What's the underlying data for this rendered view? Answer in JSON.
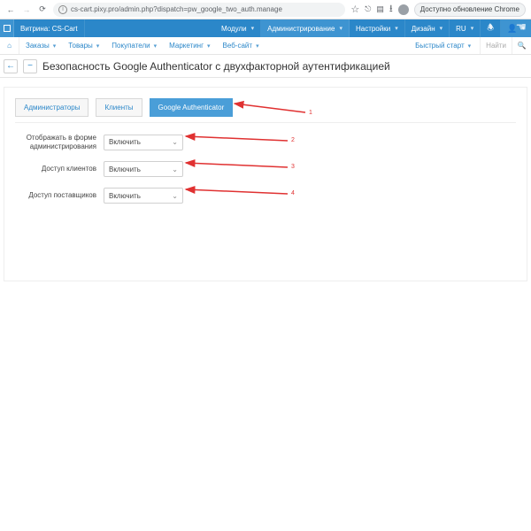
{
  "chrome": {
    "url": "cs-cart.pixy.pro/admin.php?dispatch=pw_google_two_auth.manage",
    "update_label": "Доступно обновление Chrome"
  },
  "topbar": {
    "storefront": "Витрина: CS-Cart",
    "items": [
      "Модули",
      "Администрирование",
      "Настройки",
      "Дизайн"
    ],
    "lang": "RU"
  },
  "subbar": {
    "items": [
      "Заказы",
      "Товары",
      "Покупатели",
      "Маркетинг",
      "Веб-сайт"
    ],
    "quick": "Быстрый старт",
    "search_placeholder": "Найти"
  },
  "title": "Безопасность Google Authenticator с двухфакторной аутентификацией",
  "tabs": {
    "t1": "Администраторы",
    "t2": "Клиенты",
    "t3": "Google Authenticator"
  },
  "form": {
    "r1_label": "Отображать в форме администрирования",
    "r2_label": "Доступ клиентов",
    "r3_label": "Доступ поставщиков",
    "on": "Включить"
  },
  "ann": {
    "n1": "1",
    "n2": "2",
    "n3": "3",
    "n4": "4"
  }
}
